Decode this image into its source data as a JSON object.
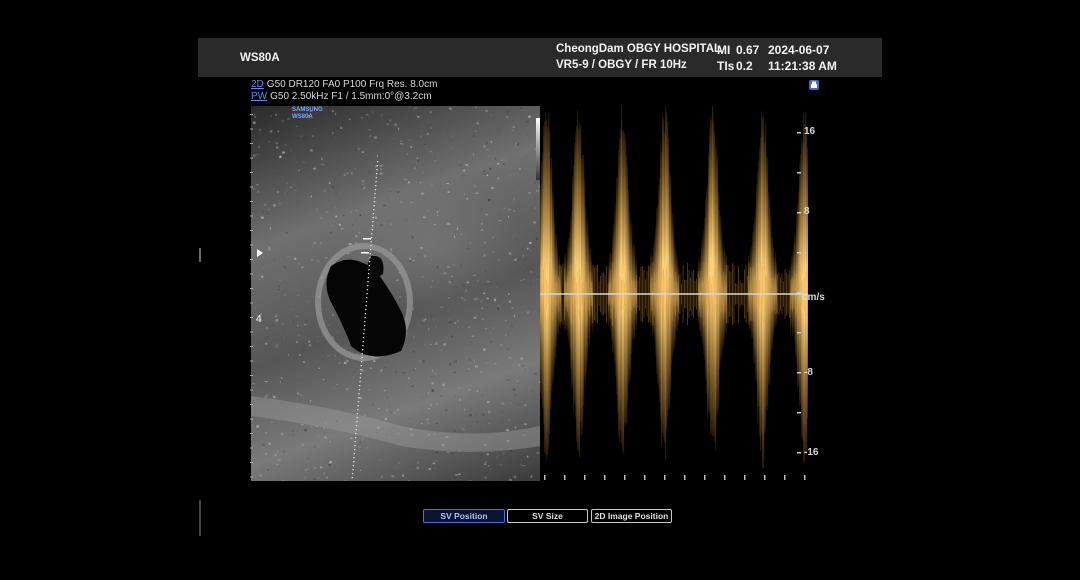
{
  "header": {
    "device": "WS80A",
    "hospital": "CheongDam OBGY HOSPITAL",
    "preset": "VR5-9 / OBGY / FR 10Hz",
    "mi_label": "MI",
    "mi_value": "0.67",
    "tis_label": "TIs",
    "tis_value": "0.2",
    "date": "2024-06-07",
    "time": "11:21:38 AM"
  },
  "params": {
    "line1_mode": "2D",
    "line1_text": "G50 DR120 FA0 P100 Frq Res. 8.0cm",
    "line2_mode": "PW",
    "line2_text": "G50 2.50kHz F1 / 1.5mm:0°@3.2cm"
  },
  "bmode": {
    "logo_line1": "SAMSUNG",
    "logo_line2": "WS80A",
    "depth_label": "4"
  },
  "doppler": {
    "scale_labels": [
      "16",
      "8",
      "cm/s",
      "-8",
      "-16"
    ],
    "waveform_color": "#d9962e"
  },
  "buttons": [
    {
      "label": "SV Position",
      "active": true
    },
    {
      "label": "SV Size",
      "active": false
    },
    {
      "label": "2D Image Position",
      "active": false
    }
  ],
  "colors": {
    "header_bg": "#2a2a2a",
    "mode_blue": "#5a8ff0",
    "active_button": "#4a74d8"
  }
}
